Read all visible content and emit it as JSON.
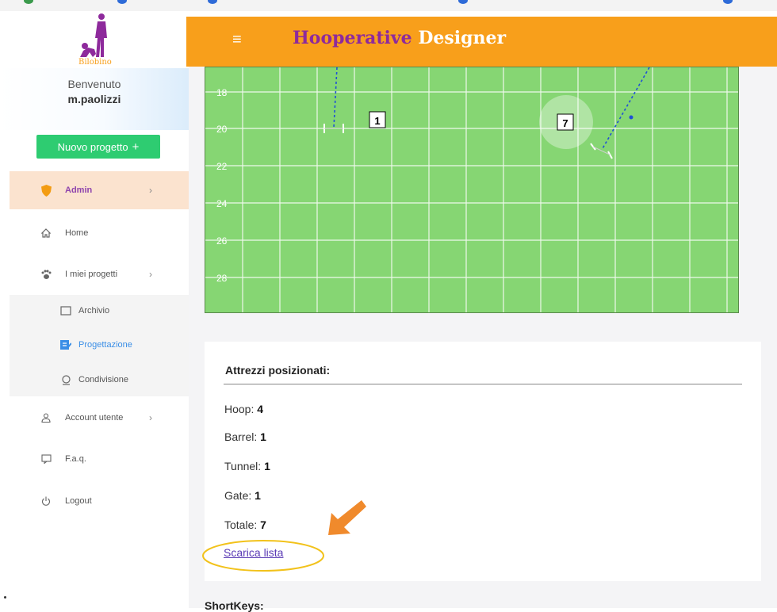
{
  "header": {
    "brand_part1": "Hooperative",
    "brand_part2": "Designer",
    "menu_icon": "hamburger-icon",
    "colors": {
      "bar": "#f89f1b",
      "brand_purple": "#8e2a9c"
    }
  },
  "sidebar": {
    "logo_text": "Bilobino",
    "welcome": "Benvenuto",
    "username": "m.paolizzi",
    "new_project": "Nuovo progetto",
    "new_project_icon": "plus-icon",
    "items": [
      {
        "label": "Admin",
        "icon": "shield-icon",
        "chevron": "›"
      },
      {
        "label": "Home",
        "icon": "home-icon"
      },
      {
        "label": "I miei progetti",
        "icon": "paw-icon",
        "chevron": "›"
      },
      {
        "label": "Account utente",
        "icon": "user-icon",
        "chevron": "›"
      },
      {
        "label": "F.a.q.",
        "icon": "faq-icon"
      },
      {
        "label": "Logout",
        "icon": "power-icon"
      }
    ],
    "subitems": [
      {
        "label": "Archivio",
        "icon": "archive-icon"
      },
      {
        "label": "Progettazione",
        "icon": "design-icon",
        "active": true
      },
      {
        "label": "Condivisione",
        "icon": "share-icon"
      }
    ]
  },
  "field": {
    "y_labels": [
      "18",
      "20",
      "22",
      "24",
      "26",
      "28"
    ],
    "markers": [
      "1",
      "7"
    ],
    "color": "#86d673"
  },
  "summary": {
    "title": "Attrezzi posizionati:",
    "stats": [
      {
        "label": "Hoop:",
        "value": "4"
      },
      {
        "label": "Barrel:",
        "value": "1"
      },
      {
        "label": "Tunnel:",
        "value": "1"
      },
      {
        "label": "Gate:",
        "value": "1"
      },
      {
        "label": "Totale:",
        "value": "7"
      }
    ],
    "download": "Scarica lista"
  },
  "footer": {
    "shortkeys": "ShortKeys:"
  }
}
